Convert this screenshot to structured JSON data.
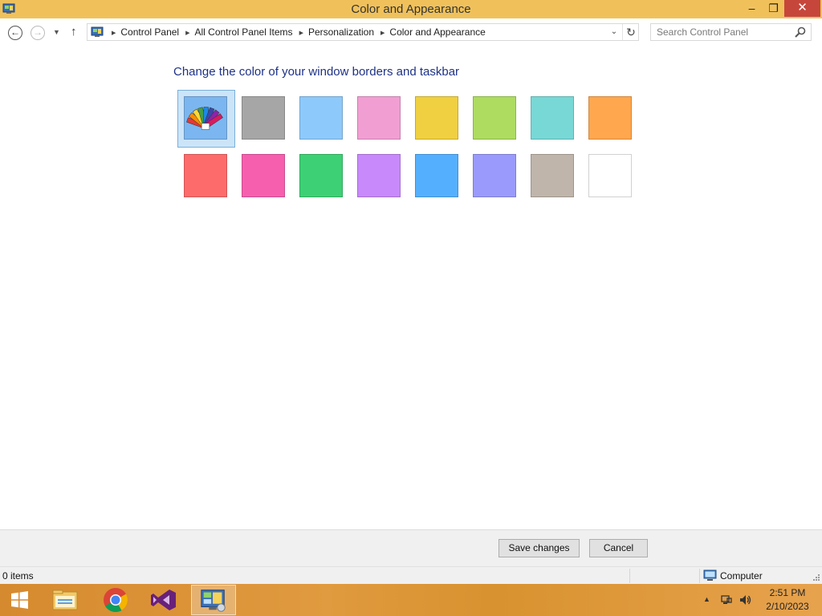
{
  "window": {
    "title": "Color and Appearance",
    "controls": {
      "minimize": "–",
      "maximize": "❐",
      "close": "✕"
    }
  },
  "nav": {
    "back_glyph": "←",
    "forward_glyph": "→",
    "recent_glyph": "▼",
    "up_glyph": "↑",
    "breadcrumbs": [
      "Control Panel",
      "All Control Panel Items",
      "Personalization",
      "Color and Appearance"
    ],
    "crumb_separator": "▶",
    "dropdown_glyph": "⌄",
    "refresh_glyph": "↻",
    "search_placeholder": "Search Control Panel"
  },
  "main": {
    "heading": "Change the color of your window borders and taskbar",
    "swatches": [
      {
        "name": "automatic",
        "color": "#7cb6f0",
        "selected": true,
        "icon": "color-palette-icon"
      },
      {
        "name": "gray",
        "color": "#a6a6a6"
      },
      {
        "name": "light-blue",
        "color": "#8ec9fb"
      },
      {
        "name": "pink",
        "color": "#f19fd3"
      },
      {
        "name": "yellow",
        "color": "#f0d040"
      },
      {
        "name": "lime",
        "color": "#addc60"
      },
      {
        "name": "teal",
        "color": "#78d8d6"
      },
      {
        "name": "orange",
        "color": "#ffa74f"
      },
      {
        "name": "red",
        "color": "#fe6b6b"
      },
      {
        "name": "magenta",
        "color": "#f65fae"
      },
      {
        "name": "green",
        "color": "#3ed075"
      },
      {
        "name": "violet",
        "color": "#c889fb"
      },
      {
        "name": "blue",
        "color": "#54b0ff"
      },
      {
        "name": "periwinkle",
        "color": "#9a9afd"
      },
      {
        "name": "taupe",
        "color": "#c0b5ab"
      },
      {
        "name": "white",
        "color": "#ffffff"
      }
    ]
  },
  "buttons": {
    "save": "Save changes",
    "cancel": "Cancel"
  },
  "status": {
    "items": "0 items",
    "location": "Computer"
  },
  "taskbar": {
    "apps": [
      "start-icon",
      "file-explorer-icon",
      "chrome-icon",
      "visual-studio-icon",
      "control-panel-icon"
    ],
    "tray_chevron": "▲",
    "time": "2:51 PM",
    "date": "2/10/2023"
  },
  "colors": {
    "titlebar": "#f0c15b",
    "heading": "#1e3287",
    "close_button": "#c7463b",
    "selection": "#cce4f7",
    "taskbar": "#d68a2f"
  }
}
